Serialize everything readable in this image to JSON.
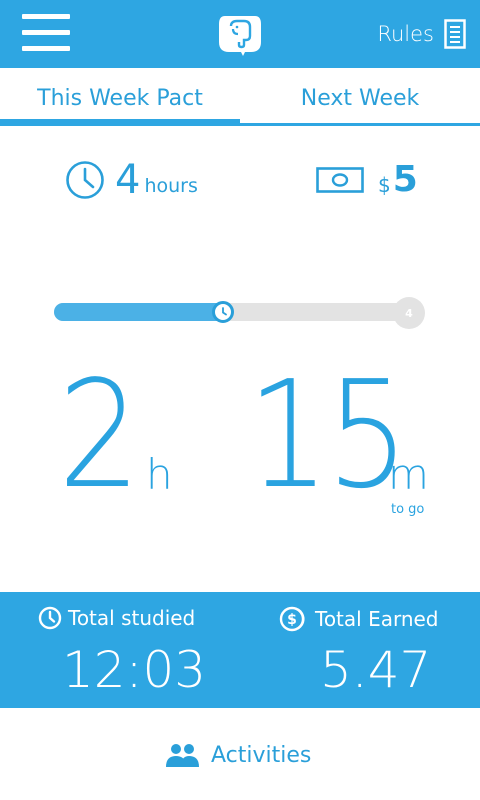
{
  "header": {
    "menu_icon": "hamburger-menu-icon",
    "logo_icon": "elephant-logo-icon",
    "rules_label": "Rules",
    "rules_icon": "document-icon",
    "background_color": "#2ea6e2"
  },
  "tabs": [
    {
      "label": "This Week Pact",
      "active": true
    },
    {
      "label": "Next Week",
      "active": false
    }
  ],
  "pact": {
    "hours_icon": "clock-icon",
    "hours_value": "4",
    "hours_unit": "hours",
    "money_icon": "banknote-icon",
    "money_symbol": "$",
    "money_value": "5"
  },
  "progress": {
    "fraction": 0.4375,
    "knob_icon": "clock-icon",
    "end_label": "4"
  },
  "countdown": {
    "hours_value": "2",
    "hours_unit": "h",
    "minutes_value": "15",
    "minutes_unit": "m",
    "caption": "to go"
  },
  "stats": {
    "studied": {
      "icon": "clock-icon",
      "label": "Total studied",
      "value": "12:03"
    },
    "earned": {
      "icon": "dollar-coin-icon",
      "label": "Total Earned",
      "value": "5.47"
    }
  },
  "footer": {
    "activities_icon": "users-icon",
    "activities_label": "Activities"
  },
  "colors": {
    "accent": "#2ea6e2",
    "text_blue": "#2a9fd9",
    "track_gray": "#e3e3e3"
  }
}
